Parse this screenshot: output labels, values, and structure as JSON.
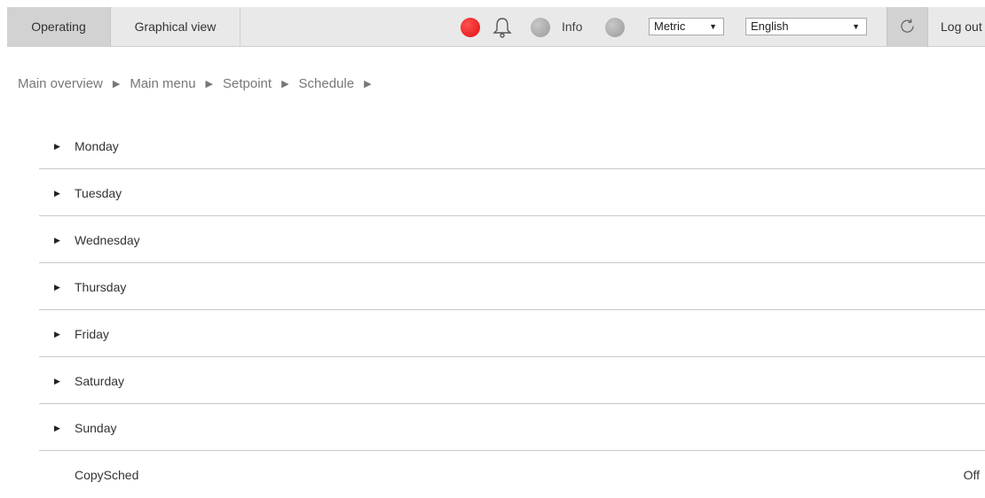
{
  "tabs": {
    "operating": "Operating",
    "graphical": "Graphical view"
  },
  "status": {
    "info_label": "Info",
    "alarm_color": "#e01010",
    "idle_color": "#9a9a9a"
  },
  "units_select": {
    "value": "Metric"
  },
  "language_select": {
    "value": "English"
  },
  "logout_label": "Log out",
  "breadcrumb": [
    "Main overview",
    "Main menu",
    "Setpoint",
    "Schedule"
  ],
  "days": [
    "Monday",
    "Tuesday",
    "Wednesday",
    "Thursday",
    "Friday",
    "Saturday",
    "Sunday"
  ],
  "copy_sched": {
    "label": "CopySched",
    "value": "Off"
  }
}
